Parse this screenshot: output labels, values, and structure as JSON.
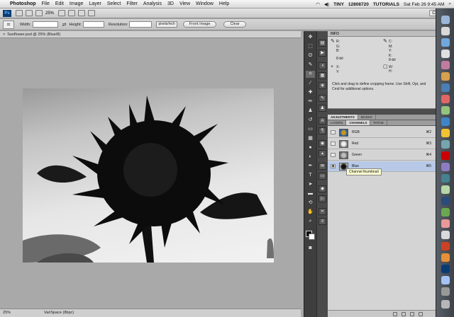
{
  "menubar": {
    "app": "Photoshop",
    "items": [
      "File",
      "Edit",
      "Image",
      "Layer",
      "Select",
      "Filter",
      "Analysis",
      "3D",
      "View",
      "Window",
      "Help"
    ],
    "status": [
      "TINY",
      "12808720",
      "TUTORIALS"
    ],
    "datetime": "Sat Feb 26  9:45 AM"
  },
  "appbar": {
    "logo": "Ps",
    "zoom": "25%",
    "cs_live": "CS Live"
  },
  "options": {
    "width_label": "Width:",
    "height_label": "Height:",
    "resolution_label": "Resolution:",
    "units": "pixels/inch",
    "front_image": "Front Image",
    "clear": "Clear"
  },
  "document": {
    "tab_title": "Sunflower.psd @ 25% (Blue/8)"
  },
  "statusbar": {
    "zoom": "25%",
    "status": "VariSpace (8bpc)"
  },
  "info_panel": {
    "title": "INFO",
    "r": "R:",
    "g": "G:",
    "b": "B:",
    "x": "X:",
    "y": "Y:",
    "c": "C:",
    "m": "M:",
    "yk": "Y:",
    "k": "K:",
    "w": "W:",
    "h": "H:",
    "bit1": "8-bit",
    "bit2": "8-bit",
    "hint": "Click and drag to define cropping frame. Use Shift, Opt, and Cmd for additional options."
  },
  "adjust_tabs": [
    "ADJUSTMENTS",
    "MASKS"
  ],
  "channel_tabs": [
    "LAYERS",
    "CHANNELS",
    "PATHS"
  ],
  "channels": [
    {
      "name": "RGB",
      "key": "⌘2"
    },
    {
      "name": "Red",
      "key": "⌘3"
    },
    {
      "name": "Green",
      "key": "⌘4"
    },
    {
      "name": "Blue",
      "key": "⌘5"
    }
  ],
  "tooltip": "Channel thumbnail"
}
